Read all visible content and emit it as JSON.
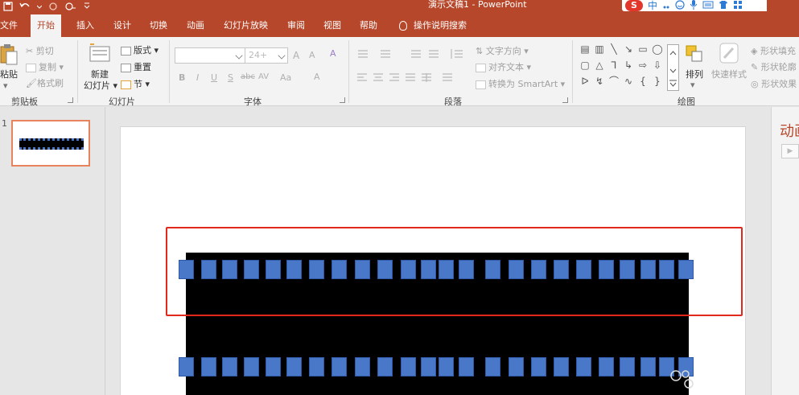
{
  "title_bar": {
    "doc_title": "演示文稿1  -  PowerPoint",
    "qat_icons": [
      "save-icon",
      "undo-icon",
      "redo-icon",
      "touch-mode-icon",
      "customize-qat-icon"
    ],
    "right_icons": [
      "sogou-ime-icon",
      "chinese-mode-icon",
      "punctuation-icon",
      "emoji-icon",
      "microphone-icon",
      "keyboard-icon",
      "tshirt-icon",
      "tools-icon"
    ],
    "sogou_label": "S",
    "ime_text": "中",
    "brand_color": "#b7472a"
  },
  "tabs": [
    {
      "label": "文件",
      "active": false
    },
    {
      "label": "开始",
      "active": true
    },
    {
      "label": "插入",
      "active": false
    },
    {
      "label": "设计",
      "active": false
    },
    {
      "label": "切换",
      "active": false
    },
    {
      "label": "动画",
      "active": false
    },
    {
      "label": "幻灯片放映",
      "active": false
    },
    {
      "label": "审阅",
      "active": false
    },
    {
      "label": "视图",
      "active": false
    },
    {
      "label": "帮助",
      "active": false
    }
  ],
  "tell_me": "操作说明搜索",
  "ribbon": {
    "clipboard": {
      "label": "剪贴板",
      "paste": "粘贴",
      "cut": "剪切",
      "copy": "复制",
      "format_painter": "格式刷"
    },
    "slides": {
      "label": "幻灯片",
      "new_slide_line1": "新建",
      "new_slide_line2": "幻灯片",
      "layout": "版式",
      "reset": "重置",
      "section": "节"
    },
    "font": {
      "label": "字体",
      "font_name": "",
      "font_size": "24+",
      "grow": "A",
      "shrink": "A",
      "clear": "A",
      "bold": "B",
      "italic": "I",
      "underline": "U",
      "shadow": "S",
      "strike": "abc",
      "spacing": "AV",
      "case": "Aa",
      "color": "A"
    },
    "paragraph": {
      "label": "段落",
      "text_direction": "文字方向",
      "align_text": "对齐文本",
      "smartart": "转换为 SmartArt"
    },
    "drawing": {
      "label": "绘图",
      "arrange": "排列",
      "quick_styles": "快速样式",
      "shape_fill": "形状填充",
      "shape_outline": "形状轮廓",
      "shape_effects": "形状效果"
    }
  },
  "slide_pane": {
    "slide_number": "1"
  },
  "right_pane": {
    "title": "动画"
  },
  "film": {
    "hole_color": "#4a78c8",
    "film_color": "#000000",
    "top_row_count": 24,
    "bottom_row_count": 24
  }
}
